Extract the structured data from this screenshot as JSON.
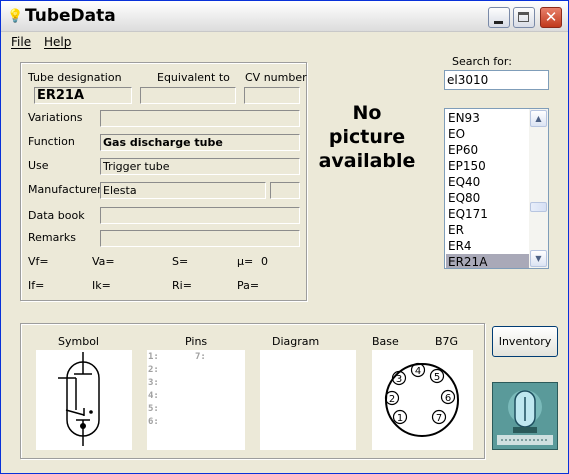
{
  "window": {
    "title": "TubeData"
  },
  "menu": {
    "file_label": "File",
    "help_label": "Help"
  },
  "tube": {
    "designation_label": "Tube designation",
    "designation": "ER21A",
    "equivalent_label": "Equivalent to",
    "equivalent": "",
    "cv_label": "CV number",
    "cv": "",
    "variations_label": "Variations",
    "variations": "",
    "function_label": "Function",
    "function": "Gas discharge tube",
    "use_label": "Use",
    "use": "Trigger tube",
    "manufacturer_label": "Manufacturer",
    "manufacturer": "Elesta",
    "manufacturer_code": "",
    "databook_label": "Data book",
    "databook": "",
    "remarks_label": "Remarks",
    "remarks": "",
    "params": {
      "vf": "Vf=",
      "va": "Va=",
      "s": "S=",
      "mu": "µ=",
      "mu_value": "0",
      "if": "If=",
      "ik": "Ik=",
      "ri": "Ri=",
      "pa": "Pa="
    }
  },
  "picture": {
    "line1": "No",
    "line2": "picture",
    "line3": "available"
  },
  "search": {
    "label": "Search for:",
    "value": "el3010",
    "results": [
      "EN93",
      "EO",
      "EP60",
      "EP150",
      "EQ40",
      "EQ80",
      "EQ171",
      "ER",
      "ER4",
      "ER21A"
    ],
    "selected": "ER21A"
  },
  "bottom": {
    "symbol_label": "Symbol",
    "pins_label": "Pins",
    "diagram_label": "Diagram",
    "base_label": "Base",
    "base_type": "B7G",
    "pins": [
      "1:",
      "2:",
      "3:",
      "4:",
      "5:",
      "6:",
      "7:"
    ],
    "base_pins": [
      "1",
      "2",
      "3",
      "4",
      "5",
      "6",
      "7"
    ]
  },
  "inventory_label": "Inventory",
  "icons": [
    "app-bulb-icon",
    "minimize-icon",
    "maximize-icon",
    "close-icon",
    "scroll-up-icon",
    "scroll-down-icon",
    "tube-logo-icon"
  ]
}
